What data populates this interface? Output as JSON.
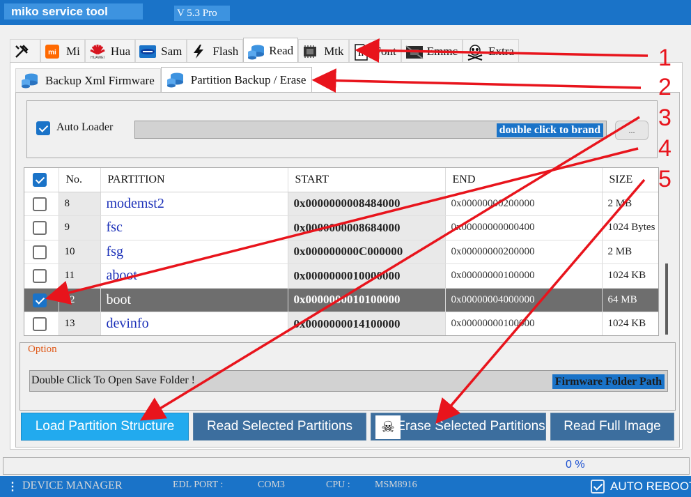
{
  "app": {
    "title": "miko service tool",
    "version": "V 5.3 Pro"
  },
  "main_tabs": [
    {
      "label": "",
      "icon": "tools-icon"
    },
    {
      "label": "Mi",
      "icon": "mi-logo-icon"
    },
    {
      "label": "Hua",
      "icon": "huawei-logo-icon"
    },
    {
      "label": "Sam",
      "icon": "samsung-logo-icon"
    },
    {
      "label": "Flash",
      "icon": "lightning-icon"
    },
    {
      "label": "Read",
      "icon": "database-icon",
      "active": true
    },
    {
      "label": "Mtk",
      "icon": "chip-icon"
    },
    {
      "label": "Font",
      "icon": "font-icon"
    },
    {
      "label": "Emmc",
      "icon": "emmc-icon"
    },
    {
      "label": "Extra",
      "icon": "skull-icon"
    }
  ],
  "sub_tabs": [
    {
      "label": "Backup Xml Firmware",
      "icon": "database-icon"
    },
    {
      "label": "Partition Backup / Erase",
      "icon": "database-icon",
      "active": true
    }
  ],
  "loader": {
    "auto_loader_label": "Auto Loader",
    "auto_loader_checked": true,
    "field_hint": "double click to brand",
    "browse_label": "..."
  },
  "table": {
    "headers": [
      "No.",
      "PARTITION",
      "START",
      "END",
      "SIZE"
    ],
    "rows": [
      {
        "no": "8",
        "name": "modemst2",
        "start": "0x0000000008484000",
        "end": "0x00000000200000",
        "size": "2 MB",
        "checked": false
      },
      {
        "no": "9",
        "name": "fsc",
        "start": "0x0000000008684000",
        "end": "0x00000000000400",
        "size": "1024 Bytes",
        "checked": false
      },
      {
        "no": "10",
        "name": "fsg",
        "start": "0x000000000C000000",
        "end": "0x00000000200000",
        "size": "2 MB",
        "checked": false
      },
      {
        "no": "11",
        "name": "aboot",
        "start": "0x0000000010000000",
        "end": "0x00000000100000",
        "size": "1024 KB",
        "checked": false
      },
      {
        "no": "12",
        "name": "boot",
        "start": "0x0000000010100000",
        "end": "0x00000004000000",
        "size": "64 MB",
        "checked": true,
        "selected": true
      },
      {
        "no": "13",
        "name": "devinfo",
        "start": "0x0000000014100000",
        "end": "0x00000000100000",
        "size": "1024 KB",
        "checked": false
      }
    ]
  },
  "option": {
    "title": "Option",
    "save_folder_text": "Double Click To Open Save Folder !",
    "folder_path_label": "Firmware Folder Path"
  },
  "actions": {
    "load": "Load Partition Structure",
    "read_selected": "Read Selected Partitions",
    "erase_selected": "Erase Selected Partitions",
    "read_full": "Read Full Image"
  },
  "progress": {
    "text": "0  %"
  },
  "status": {
    "device_manager": "DEVICE MANAGER",
    "edl_port_label": "EDL PORT  :",
    "edl_port_value": "COM3",
    "cpu_label": "CPU :",
    "cpu_value": "MSM8916",
    "auto_reboot_label": "AUTO REBOOT",
    "auto_reboot_checked": true
  },
  "annotations": [
    "1",
    "2",
    "3",
    "4",
    "5"
  ],
  "colors": {
    "accent": "#1a73c8",
    "annotation": "#e8141c",
    "primary_button": "#22aaee",
    "button": "#3c6e9e"
  }
}
